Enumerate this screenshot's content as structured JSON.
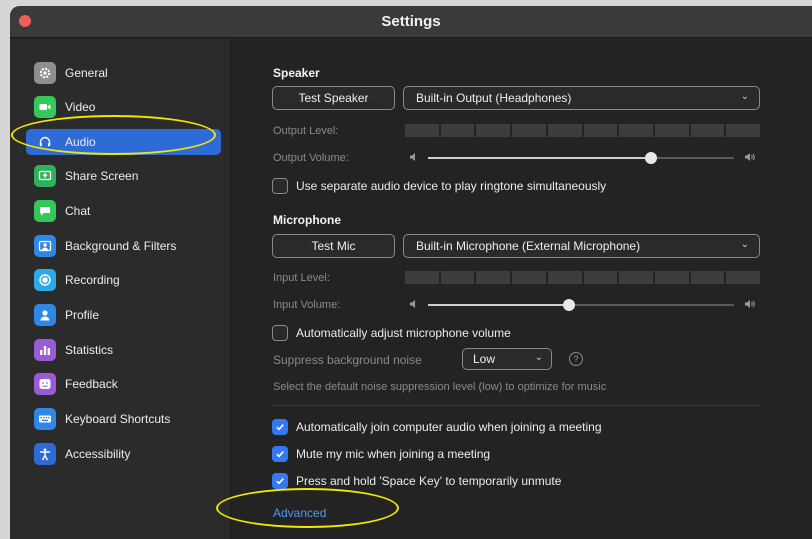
{
  "window": {
    "title": "Settings"
  },
  "sidebar": {
    "items": [
      {
        "label": "General",
        "icon": "gear-icon",
        "color": "#8e8e93"
      },
      {
        "label": "Video",
        "icon": "video-camera-icon",
        "color": "#34c759"
      },
      {
        "label": "Audio",
        "icon": "headphones-icon",
        "color": "#2f6bd6",
        "active": true
      },
      {
        "label": "Share Screen",
        "icon": "share-screen-icon",
        "color": "#30b05a"
      },
      {
        "label": "Chat",
        "icon": "chat-bubble-icon",
        "color": "#34c759"
      },
      {
        "label": "Background & Filters",
        "icon": "background-icon",
        "color": "#2f87e6"
      },
      {
        "label": "Recording",
        "icon": "record-icon",
        "color": "#2fa8e6"
      },
      {
        "label": "Profile",
        "icon": "person-icon",
        "color": "#2f87e6"
      },
      {
        "label": "Statistics",
        "icon": "bar-chart-icon",
        "color": "#9a5bd6"
      },
      {
        "label": "Feedback",
        "icon": "smiley-icon",
        "color": "#9a5bd6"
      },
      {
        "label": "Keyboard Shortcuts",
        "icon": "keyboard-icon",
        "color": "#2f87e6"
      },
      {
        "label": "Accessibility",
        "icon": "accessibility-icon",
        "color": "#2f6bd6"
      }
    ]
  },
  "speaker": {
    "heading": "Speaker",
    "test_button": "Test Speaker",
    "device": "Built-in Output (Headphones)",
    "output_level_label": "Output Level:",
    "output_volume_label": "Output Volume:",
    "output_volume": 0.73
  },
  "ringtone": {
    "label": "Use separate audio device to play ringtone simultaneously",
    "checked": false
  },
  "microphone": {
    "heading": "Microphone",
    "test_button": "Test Mic",
    "device": "Built-in Microphone (External Microphone)",
    "input_level_label": "Input Level:",
    "input_volume_label": "Input Volume:",
    "input_volume": 0.46
  },
  "auto_adjust": {
    "label": "Automatically adjust microphone volume",
    "checked": false
  },
  "noise": {
    "label": "Suppress background noise",
    "value": "Low",
    "help": "?",
    "description": "Select the default noise suppression level (low) to optimize for music"
  },
  "options": [
    {
      "label": "Automatically join computer audio when joining a meeting",
      "checked": true
    },
    {
      "label": "Mute my mic when joining a meeting",
      "checked": true
    },
    {
      "label": "Press and hold 'Space Key' to temporarily unmute",
      "checked": true
    }
  ],
  "advanced_link": "Advanced",
  "colors": {
    "accent": "#2f6bd6",
    "checkbox": "#3478f6",
    "link": "#4d9bf0",
    "annotation": "#f3e600"
  }
}
